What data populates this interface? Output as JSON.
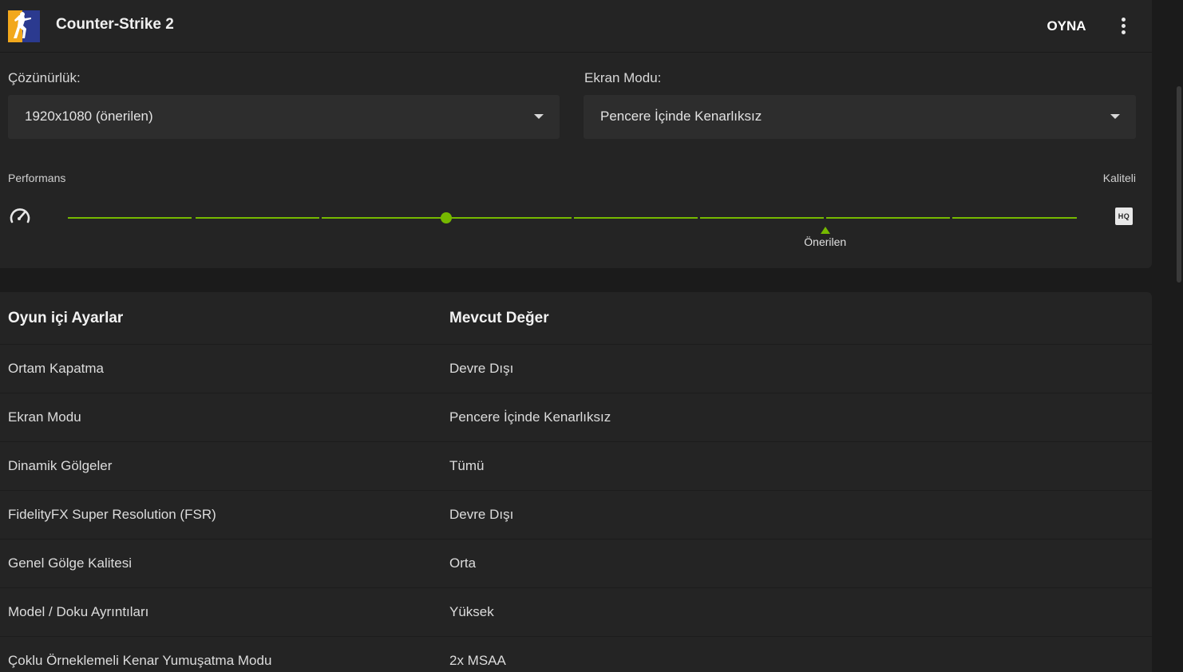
{
  "header": {
    "game_title": "Counter-Strike 2",
    "play_label": "OYNA",
    "more_icon": "kebab-menu-icon"
  },
  "settings": {
    "resolution": {
      "label": "Çözünürlük:",
      "value": "1920x1080 (önerilen)"
    },
    "display_mode": {
      "label": "Ekran Modu:",
      "value": "Pencere İçinde Kenarlıksız"
    },
    "slider": {
      "left_label": "Performans",
      "right_label": "Kaliteli",
      "left_icon": "speedometer-icon",
      "right_icon": "hq-icon",
      "right_icon_text": "HQ",
      "steps": 9,
      "current_step": 3,
      "recommended_step": 6,
      "recommended_label": "Önerilen",
      "accent_color": "#76b900"
    }
  },
  "table": {
    "headers": [
      "Oyun içi Ayarlar",
      "Mevcut Değer"
    ],
    "rows": [
      [
        "Ortam Kapatma",
        "Devre Dışı"
      ],
      [
        "Ekran Modu",
        "Pencere İçinde Kenarlıksız"
      ],
      [
        "Dinamik Gölgeler",
        "Tümü"
      ],
      [
        "FidelityFX Super Resolution (FSR)",
        "Devre Dışı"
      ],
      [
        "Genel Gölge Kalitesi",
        "Orta"
      ],
      [
        "Model / Doku Ayrıntıları",
        "Yüksek"
      ],
      [
        "Çoklu Örneklemeli Kenar Yumuşatma Modu",
        "2x MSAA"
      ]
    ]
  }
}
